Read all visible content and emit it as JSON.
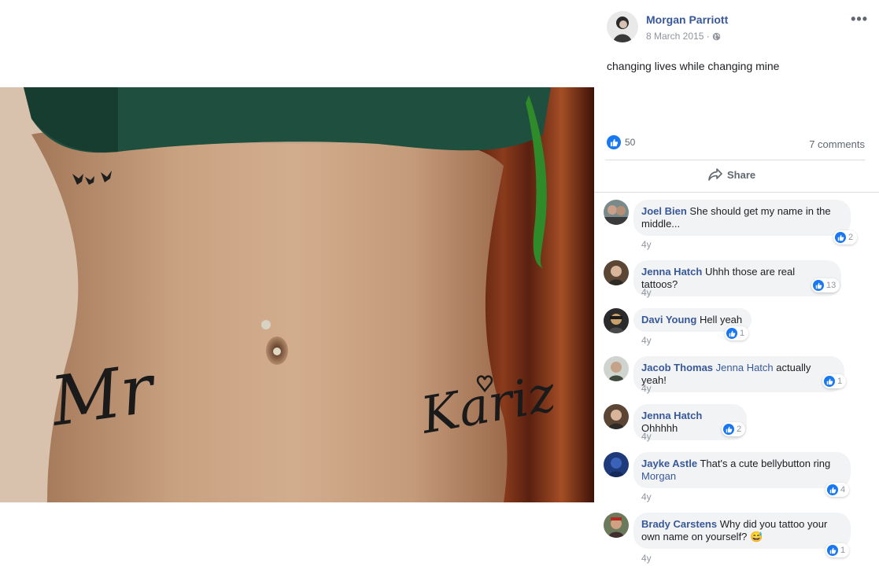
{
  "post": {
    "author": "Morgan Parriott",
    "date": "8 March 2015 ·",
    "caption": "changing lives while changing mine",
    "likes": "50",
    "comments_count": "7 comments",
    "share_label": "Share",
    "more_label": "•••"
  },
  "photo": {
    "tattoo_left": "Mr",
    "tattoo_right": "Kariz"
  },
  "comments": [
    {
      "name": "Joel Bien",
      "tag": "",
      "text": "She should get my name in the middle...",
      "age": "4y",
      "reactions": "2"
    },
    {
      "name": "Jenna Hatch",
      "tag": "",
      "text": "Uhhh those are real tattoos?",
      "age": "4y",
      "reactions": "13"
    },
    {
      "name": "Davi Young",
      "tag": "",
      "text": "Hell yeah",
      "age": "4y",
      "reactions": "1"
    },
    {
      "name": "Jacob Thomas",
      "tag": "Jenna Hatch",
      "text": "actually yeah!",
      "age": "4y",
      "reactions": "1"
    },
    {
      "name": "Jenna Hatch",
      "tag": "",
      "text": "Ohhhhh",
      "age": "4y",
      "reactions": "2"
    },
    {
      "name": "Jayke Astle",
      "tag": "Morgan",
      "text": "That's a cute bellybutton ring",
      "age": "4y",
      "reactions": "4"
    },
    {
      "name": "Brady Carstens",
      "tag": "",
      "text": "Why did you tattoo your own name on yourself? 😅",
      "age": "4y",
      "reactions": "1"
    }
  ],
  "colors": {
    "link": "#385898",
    "like_blue": "#1877f2",
    "bubble": "#f2f3f5",
    "meta": "#90949c"
  }
}
